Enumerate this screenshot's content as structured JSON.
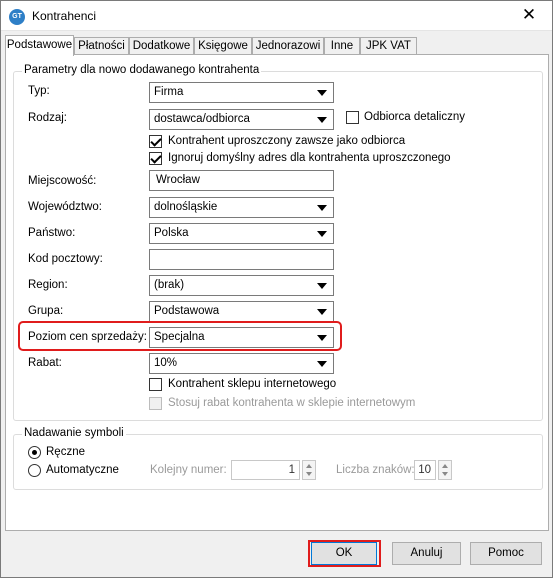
{
  "window": {
    "title": "Kontrahenci",
    "app_icon_text": "GT"
  },
  "tabs": [
    {
      "label": "Podstawowe",
      "active": true
    },
    {
      "label": "Płatności",
      "active": false
    },
    {
      "label": "Dodatkowe",
      "active": false
    },
    {
      "label": "Księgowe",
      "active": false
    },
    {
      "label": "Jednorazowi",
      "active": false
    },
    {
      "label": "Inne",
      "active": false
    },
    {
      "label": "JPK VAT",
      "active": false
    }
  ],
  "params": {
    "title": "Parametry dla nowo dodawanego kontrahenta",
    "typ": {
      "label": "Typ:",
      "value": "Firma"
    },
    "rodzaj": {
      "label": "Rodzaj:",
      "value": "dostawca/odbiorca"
    },
    "odbiorca_detaliczny": {
      "label": "Odbiorca detaliczny",
      "checked": false
    },
    "uproszczony": {
      "label": "Kontrahent uproszczony zawsze jako odbiorca",
      "checked": true
    },
    "ignoruj": {
      "label": "Ignoruj domyślny adres dla kontrahenta uproszczonego",
      "checked": true
    },
    "miejscowosc": {
      "label": "Miejscowość:",
      "value": "Wrocław"
    },
    "wojewodztwo": {
      "label": "Województwo:",
      "value": "dolnośląskie"
    },
    "panstwo": {
      "label": "Państwo:",
      "value": "Polska"
    },
    "kod": {
      "label": "Kod pocztowy:",
      "value": ""
    },
    "region": {
      "label": "Region:",
      "value": "(brak)"
    },
    "grupa": {
      "label": "Grupa:",
      "value": "Podstawowa"
    },
    "poziom": {
      "label": "Poziom cen sprzedaży:",
      "value": "Specjalna"
    },
    "rabat": {
      "label": "Rabat:",
      "value": "10%"
    },
    "sklep": {
      "label": "Kontrahent sklepu internetowego",
      "checked": false
    },
    "stosuj": {
      "label": "Stosuj rabat kontrahenta w sklepie internetowym",
      "checked": false
    }
  },
  "symbols": {
    "title": "Nadawanie symboli",
    "reczne": {
      "label": "Ręczne",
      "selected": true
    },
    "automatyczne": {
      "label": "Automatyczne",
      "selected": false
    },
    "kolejny": {
      "label": "Kolejny numer:",
      "value": "1"
    },
    "liczba": {
      "label": "Liczba znaków:",
      "value": "10"
    }
  },
  "buttons": {
    "ok": "OK",
    "anuluj": "Anuluj",
    "pomoc": "Pomoc"
  },
  "colors": {
    "highlight": "#e01c1c",
    "focus": "#0078d7"
  }
}
